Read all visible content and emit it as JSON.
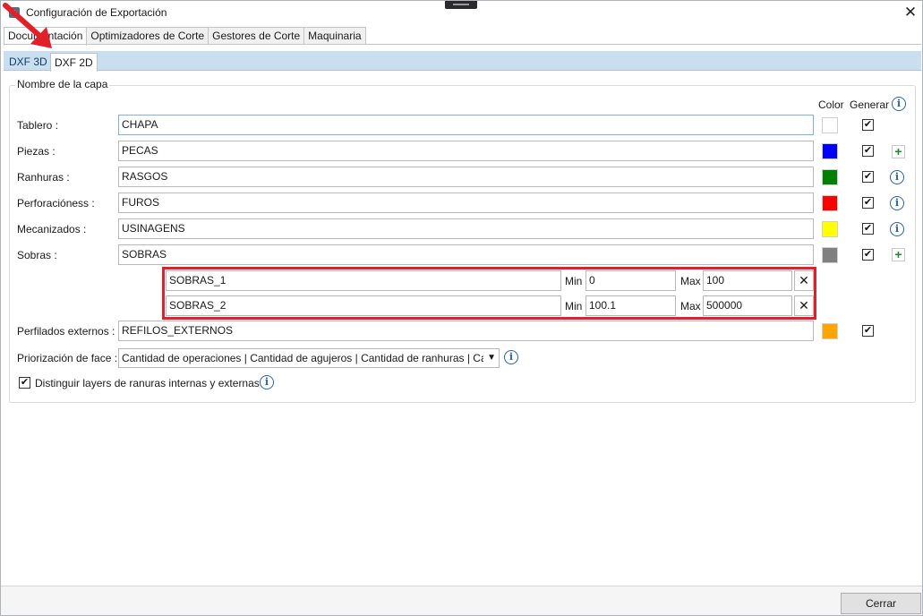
{
  "window": {
    "title": "Configuración de Exportación",
    "close_icon": "close-icon"
  },
  "tabs": [
    "Documentación",
    "Optimizadores de Corte",
    "Gestores de Corte",
    "Maquinaria"
  ],
  "subtabs": [
    "DXF 3D",
    "DXF 2D"
  ],
  "group": {
    "title": "Nombre de la capa",
    "col_color": "Color",
    "col_generar": "Generar"
  },
  "layers": [
    {
      "label": "Tablero :",
      "value": "CHAPA",
      "color": "#ffffff",
      "generar": true,
      "action": "none"
    },
    {
      "label": "Piezas :",
      "value": "PECAS",
      "color": "#0000ff",
      "generar": true,
      "action": "add"
    },
    {
      "label": "Ranhuras :",
      "value": "RASGOS",
      "color": "#008000",
      "generar": true,
      "action": "info"
    },
    {
      "label": "Perforacióness :",
      "value": "FUROS",
      "color": "#ff0000",
      "generar": true,
      "action": "info"
    },
    {
      "label": "Mecanizados :",
      "value": "USINAGENS",
      "color": "#ffff00",
      "generar": true,
      "action": "info"
    },
    {
      "label": "Sobras :",
      "value": "SOBRAS",
      "color": "#808080",
      "generar": true,
      "action": "add"
    }
  ],
  "sobras_sub": {
    "min_label": "Min",
    "max_label": "Max",
    "rows": [
      {
        "name": "SOBRAS_1",
        "min": "0",
        "max": "100"
      },
      {
        "name": "SOBRAS_2",
        "min": "100.1",
        "max": "500000"
      }
    ]
  },
  "perfilados": {
    "label": "Perfilados externos :",
    "value": "REFILOS_EXTERNOS",
    "color": "#ffa500",
    "generar": true
  },
  "priorizacion": {
    "label": "Priorización de face :",
    "value": "Cantidad de operaciones | Cantidad de agujeros | Cantidad de ranhuras | Cantidad de mecanizados"
  },
  "distinguir": {
    "label": "Distinguir layers de ranuras internas y externas",
    "checked": true
  },
  "footer": {
    "close_label": "Cerrar"
  },
  "colors": {
    "accent": "#2a64a8",
    "highlight_box": "#e3202a",
    "annotation_arrow": "#e3202a"
  }
}
